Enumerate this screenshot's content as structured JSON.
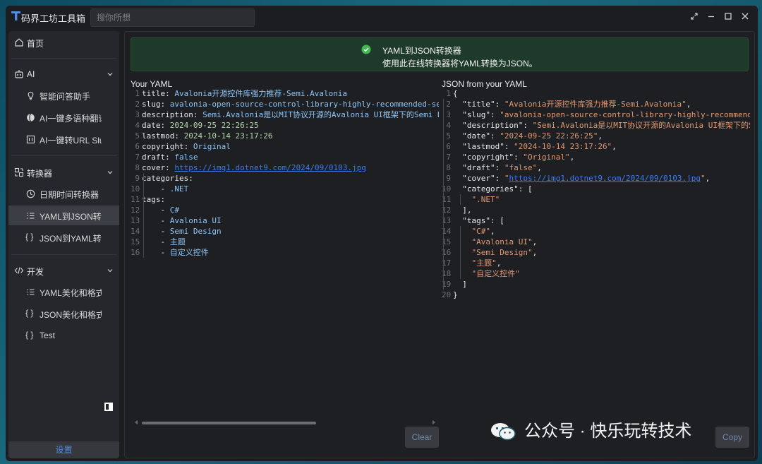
{
  "window": {
    "title": "码界工坊工具箱"
  },
  "search": {
    "placeholder": "搜你所想"
  },
  "sidebar": {
    "home": "首页",
    "groups": [
      {
        "label": "AI",
        "items": [
          "智能问答助手",
          "AI一键多语种翻译",
          "AI一键转URL Slug"
        ]
      },
      {
        "label": "转换器",
        "items": [
          "日期时间转换器",
          "YAML到JSON转换器",
          "JSON到YAML转换器"
        ]
      },
      {
        "label": "开发",
        "items": [
          "YAML美化和格式化",
          "JSON美化和格式化",
          "Test"
        ]
      }
    ],
    "active_item": "YAML到JSON转换器",
    "settings": "设置"
  },
  "banner": {
    "title": "YAML到JSON转换器",
    "description": "使用此在线转换器将YAML转换为JSON。"
  },
  "yaml_pane": {
    "label": "Your YAML",
    "lines": [
      "title: Avalonia开源控件库强力推荐-Semi.Avalonia",
      "slug: avalonia-open-source-control-library-highly-recommended-semi-avalonia",
      "description: Semi.Avalonia是以MIT协议开源的Avalonia UI框架下的Semi Design",
      "date: 2024-09-25 22:26:25",
      "lastmod: 2024-10-14 23:17:26",
      "copyright: Original",
      "draft: false",
      "cover: https://img1.dotnet9.com/2024/09/0103.jpg",
      "categories:",
      "    - .NET",
      "tags:",
      "    - C#",
      "    - Avalonia UI",
      "    - Semi Design",
      "    - 主题",
      "    - 自定义控件"
    ]
  },
  "json_pane": {
    "label": "JSON from your YAML",
    "lines": [
      "{",
      "  \"title\": \"Avalonia开源控件库强力推荐-Semi.Avalonia\",",
      "  \"slug\": \"avalonia-open-source-control-library-highly-recommended-semi-avalonia\",",
      "  \"description\": \"Semi.Avalonia是以MIT协议开源的Avalonia UI框架下的Semi Design\",",
      "  \"date\": \"2024-09-25 22:26:25\",",
      "  \"lastmod\": \"2024-10-14 23:17:26\",",
      "  \"copyright\": \"Original\",",
      "  \"draft\": \"false\",",
      "  \"cover\": \"https://img1.dotnet9.com/2024/09/0103.jpg\",",
      "  \"categories\": [",
      "    \".NET\"",
      "  ],",
      "  \"tags\": [",
      "    \"C#\",",
      "    \"Avalonia UI\",",
      "    \"Semi Design\",",
      "    \"主题\",",
      "    \"自定义控件\"",
      "  ]",
      "}"
    ]
  },
  "buttons": {
    "clear": "Clear",
    "copy": "Copy"
  },
  "watermark": "公众号 · 快乐玩转技术",
  "colors": {
    "accent": "#4f8fdc",
    "banner_bg": "#1e3a2a",
    "success": "#3fb950",
    "json_string": "#e09a72",
    "yaml_value": "#8fc6f5",
    "link": "#3b7cf0"
  }
}
